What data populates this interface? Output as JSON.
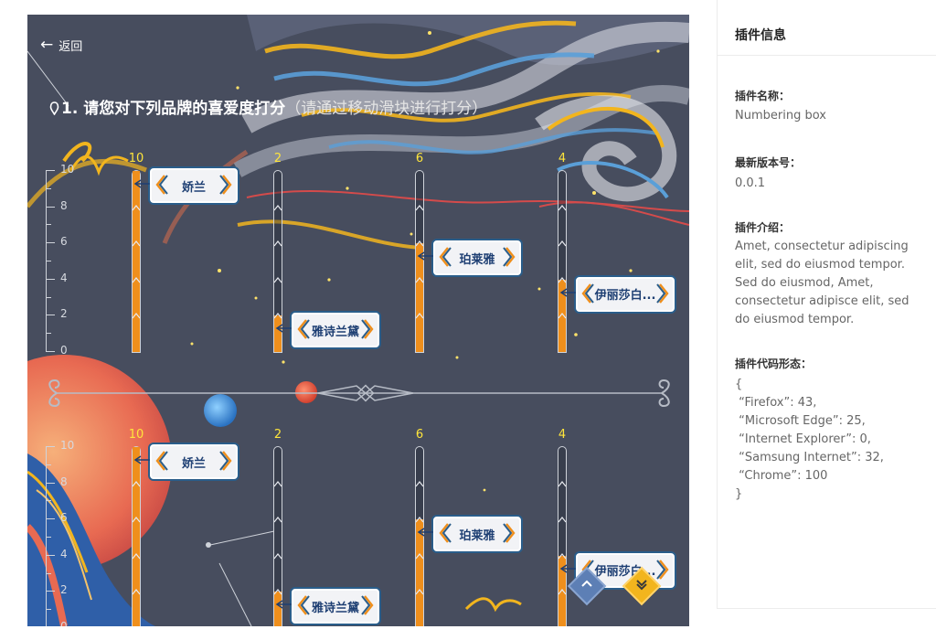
{
  "header": {
    "back_label": "返回"
  },
  "question": {
    "title": "1. 请您对下列品牌的喜爱度打分",
    "hint": "（请通过移动滑块进行打分）"
  },
  "axis_labels": [
    "10",
    "8",
    "6",
    "4",
    "2",
    "0"
  ],
  "rows": [
    {
      "items": [
        {
          "count": "10",
          "label": "娇兰",
          "score": 10
        },
        {
          "count": "2",
          "label": "雅诗兰黛",
          "score": 2
        },
        {
          "count": "6",
          "label": "珀莱雅",
          "score": 6
        },
        {
          "count": "4",
          "label": "伊丽莎白...",
          "score": 4
        }
      ]
    },
    {
      "items": [
        {
          "count": "10",
          "label": "娇兰",
          "score": 10
        },
        {
          "count": "2",
          "label": "雅诗兰黛",
          "score": 2
        },
        {
          "count": "6",
          "label": "珀莱雅",
          "score": 6
        },
        {
          "count": "4",
          "label": "伊丽莎白...",
          "score": 4
        }
      ]
    }
  ],
  "colors": {
    "fill": "#ef8f1c",
    "count": "#ffe53b",
    "tag_border": "#2a5d8a",
    "tag_text": "#1e3f73"
  },
  "panel": {
    "title": "插件信息",
    "name_title": "插件名称：",
    "name_value": "Numbering box",
    "version_title": "最新版本号：",
    "version_value": "0.0.1",
    "desc_title": "插件介绍：",
    "desc_value": "Amet, consectetur adipiscing elit, sed do eiusmod tempor. Sed do eiusmod, Amet, consectetur adipisce elit, sed do eiusmod tempor.",
    "code_title": "插件代码形态：",
    "code_lines": [
      "{",
      " “Firefox”: 43,",
      " “Microsoft Edge”: 25,",
      " “Internet Explorer”: 0,",
      " “Samsung Internet”: 32,",
      " “Chrome”: 100",
      "}"
    ]
  }
}
